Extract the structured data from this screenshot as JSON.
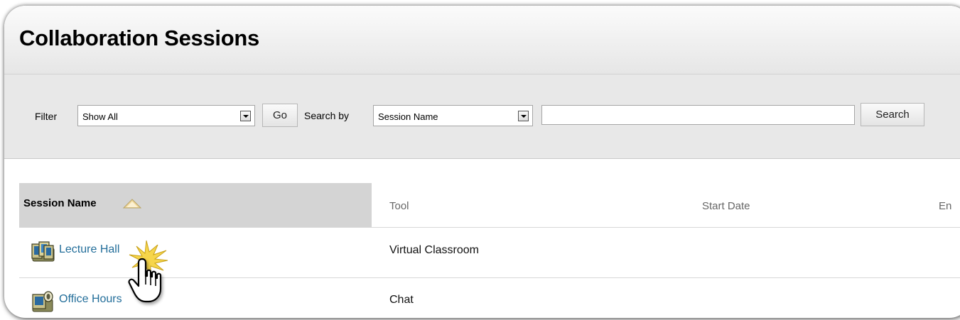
{
  "header": {
    "title": "Collaboration Sessions"
  },
  "filter_bar": {
    "filter_label": "Filter",
    "filter_value": "Show All",
    "go_label": "Go",
    "search_by_label": "Search by",
    "search_by_value": "Session Name",
    "search_input_value": "",
    "search_label": "Search"
  },
  "table": {
    "columns": [
      {
        "label": "Session Name",
        "sorted": "ascending"
      },
      {
        "label": "Tool"
      },
      {
        "label": "Start Date"
      },
      {
        "label": "En"
      }
    ],
    "rows": [
      {
        "name": "Lecture Hall",
        "tool": "Virtual Classroom",
        "icon": "virtual-classroom-icon"
      },
      {
        "name": "Office Hours",
        "tool": "Chat",
        "icon": "chat-session-icon"
      }
    ]
  },
  "colors": {
    "link": "#236e9a",
    "sorted_header_bg": "#d4d4d4",
    "filter_bar_bg": "#e8e8e8",
    "sort_arrow": "#f1d89a"
  },
  "cursor": {
    "type": "hand-pointer-icon",
    "effect": "click-burst"
  }
}
